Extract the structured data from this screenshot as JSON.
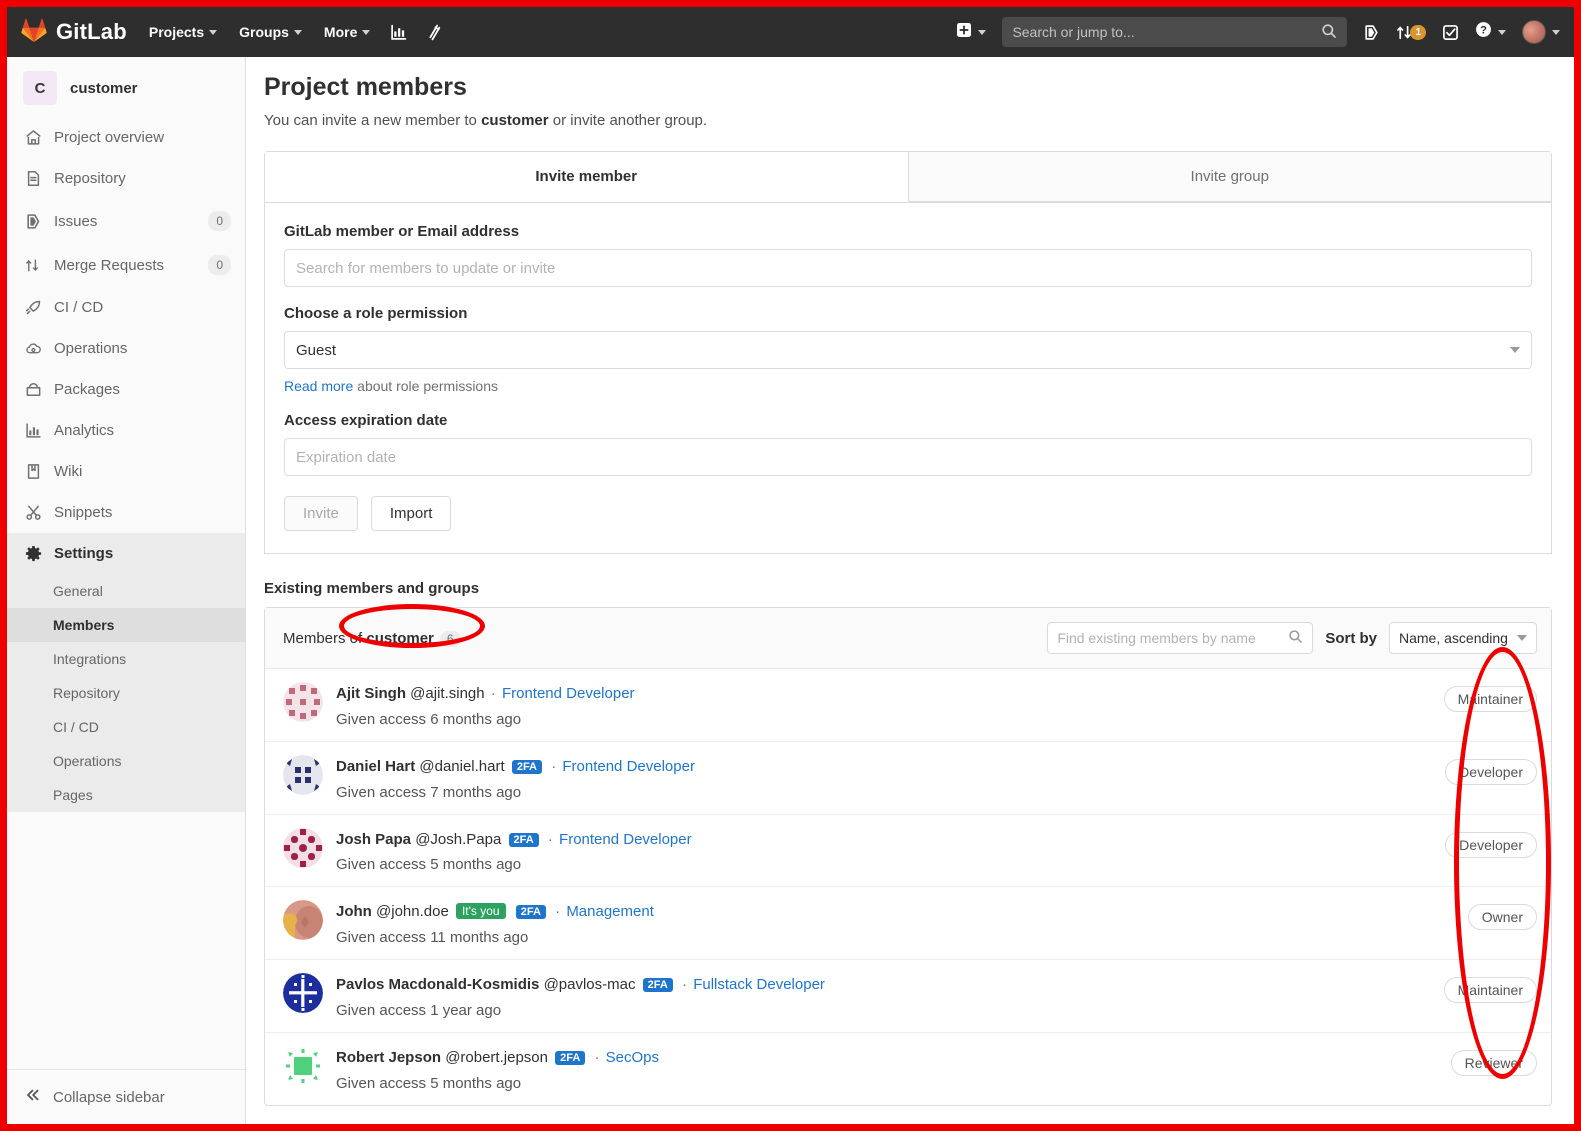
{
  "navbar": {
    "brand": "GitLab",
    "links": [
      {
        "label": "Projects",
        "icon": "chevron-down-icon"
      },
      {
        "label": "Groups",
        "icon": "chevron-down-icon"
      },
      {
        "label": "More",
        "icon": "chevron-down-icon"
      }
    ],
    "left_icons": [
      "analytics-icon",
      "pipeline-wand-icon"
    ],
    "create_icon": "plus-square-icon",
    "search_placeholder": "Search or jump to...",
    "search_icon": "search-icon",
    "issues_icon": "issues-icon",
    "merge_requests_icon": "merge-request-icon",
    "merge_requests_count": "1",
    "todos_icon": "todo-check-icon",
    "help_icon": "question-circle-icon",
    "avatar_icon": "user-avatar"
  },
  "sidebar": {
    "project_initial": "C",
    "project_name": "customer",
    "items": [
      {
        "label": "Project overview",
        "icon": "home-icon",
        "count": null
      },
      {
        "label": "Repository",
        "icon": "document-icon",
        "count": null
      },
      {
        "label": "Issues",
        "icon": "issues-icon",
        "count": "0"
      },
      {
        "label": "Merge Requests",
        "icon": "merge-request-icon",
        "count": "0"
      },
      {
        "label": "CI / CD",
        "icon": "rocket-icon",
        "count": null
      },
      {
        "label": "Operations",
        "icon": "cloud-gear-icon",
        "count": null
      },
      {
        "label": "Packages",
        "icon": "package-icon",
        "count": null
      },
      {
        "label": "Analytics",
        "icon": "chart-bar-icon",
        "count": null
      },
      {
        "label": "Wiki",
        "icon": "book-icon",
        "count": null
      },
      {
        "label": "Snippets",
        "icon": "scissors-icon",
        "count": null
      }
    ],
    "settings": {
      "label": "Settings",
      "icon": "gear-icon"
    },
    "settings_sub": [
      {
        "label": "General"
      },
      {
        "label": "Members"
      },
      {
        "label": "Integrations"
      },
      {
        "label": "Repository"
      },
      {
        "label": "CI / CD"
      },
      {
        "label": "Operations"
      },
      {
        "label": "Pages"
      }
    ],
    "active_sub": "Members",
    "collapse": {
      "label": "Collapse sidebar",
      "icon": "double-chevron-left-icon"
    }
  },
  "main": {
    "title": "Project members",
    "subtitle_before": "You can invite a new member to ",
    "subtitle_bold": "customer",
    "subtitle_after": " or invite another group.",
    "tabs": [
      {
        "label": "Invite member",
        "active": true
      },
      {
        "label": "Invite group",
        "active": false
      }
    ],
    "form": {
      "member_label": "GitLab member or Email address",
      "member_placeholder": "Search for members to update or invite",
      "role_label": "Choose a role permission",
      "role_value": "Guest",
      "hint_link": "Read more",
      "hint_rest": " about role permissions",
      "expiration_label": "Access expiration date",
      "expiration_placeholder": "Expiration date",
      "invite_button": "Invite",
      "import_button": "Import"
    },
    "existing_title": "Existing members and groups",
    "members_header": {
      "prefix": "Members of ",
      "project": "customer",
      "count": "6",
      "find_placeholder": "Find existing members by name",
      "find_icon": "search-icon",
      "sort_label": "Sort by",
      "sort_value": "Name, ascending",
      "sort_icon": "chevron-down-icon"
    },
    "members": [
      {
        "name": "Ajit Singh",
        "handle": "@ajit.singh",
        "two_fa": false,
        "you": false,
        "job": "Frontend Developer",
        "access": "Given access 6 months ago",
        "role": "Maintainer",
        "avatar_bg": "#c0697a"
      },
      {
        "name": "Daniel Hart",
        "handle": "@daniel.hart",
        "two_fa": true,
        "you": false,
        "job": "Frontend Developer",
        "access": "Given access 7 months ago",
        "role": "Developer",
        "avatar_bg": "#2b2f6b"
      },
      {
        "name": "Josh Papa",
        "handle": "@Josh.Papa",
        "two_fa": true,
        "you": false,
        "job": "Frontend Developer",
        "access": "Given access 5 months ago",
        "role": "Developer",
        "avatar_bg": "#9e1f4a"
      },
      {
        "name": "John",
        "handle": "@john.doe",
        "two_fa": true,
        "you": true,
        "you_label": "It's you",
        "job": "Management",
        "access": "Given access 11 months ago",
        "role": "Owner",
        "avatar_bg": "#c98f80"
      },
      {
        "name": "Pavlos Macdonald-Kosmidis",
        "handle": "@pavlos-mac",
        "two_fa": true,
        "you": false,
        "job": "Fullstack Developer",
        "access": "Given access 1 year ago",
        "role": "Maintainer",
        "avatar_bg": "#1c2d9e"
      },
      {
        "name": "Robert Jepson",
        "handle": "@robert.jepson",
        "two_fa": true,
        "you": false,
        "job": "SecOps",
        "access": "Given access 5 months ago",
        "role": "Reviewer",
        "avatar_bg": "#4fd07a"
      }
    ],
    "two_fa_label": "2FA"
  },
  "colors": {
    "navbar_bg": "#2e2e2e",
    "link_blue": "#1f75cb",
    "badge_blue": "#1f75cb",
    "badge_green": "#2da160",
    "annotation_red": "#ee0000",
    "gitlab_orange": "#e24329"
  }
}
